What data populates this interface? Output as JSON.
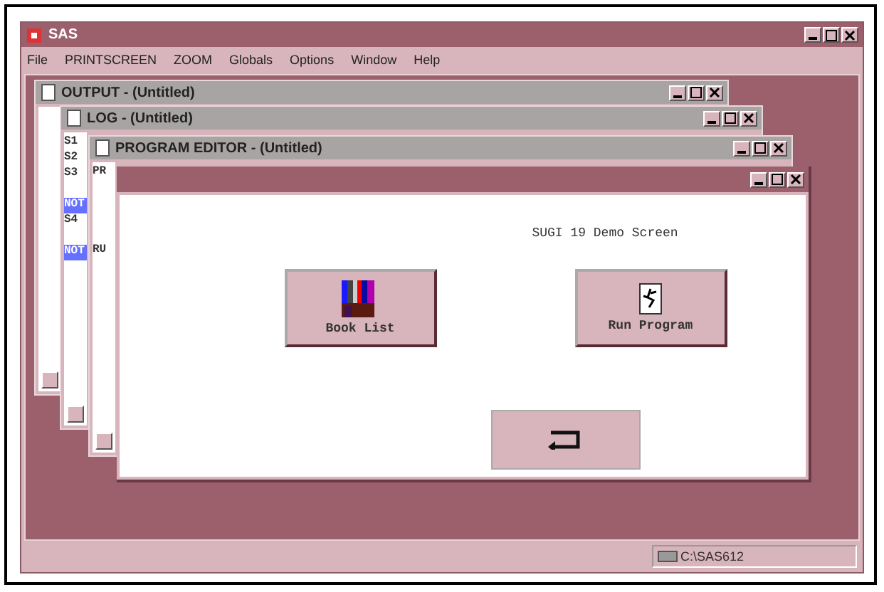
{
  "app_window": {
    "title": "SAS"
  },
  "menu": [
    "File",
    "PRINTSCREEN",
    "ZOOM",
    "Globals",
    "Options",
    "Window",
    "Help"
  ],
  "child_windows": [
    {
      "title": "OUTPUT - (Untitled)",
      "active": false
    },
    {
      "title": "LOG - (Untitled)",
      "active": false,
      "lines": [
        {
          "text": "S1",
          "kind": "plain"
        },
        {
          "text": "S2",
          "kind": "plain"
        },
        {
          "text": "S3",
          "kind": "plain"
        },
        {
          "kind": "gap"
        },
        {
          "text": "NOT",
          "kind": "note"
        },
        {
          "text": "S4",
          "kind": "plain"
        },
        {
          "kind": "gap"
        },
        {
          "text": "NOT",
          "kind": "note"
        }
      ]
    },
    {
      "title": "PROGRAM EDITOR - (Untitled)",
      "active": false,
      "lines": [
        {
          "text": "PR",
          "kind": "plain"
        },
        {
          "kind": "gap"
        },
        {
          "kind": "gap"
        },
        {
          "kind": "gap"
        },
        {
          "kind": "gap"
        },
        {
          "text": "RU",
          "kind": "plain"
        }
      ]
    }
  ],
  "dialog": {
    "heading": "SUGI 19 Demo Screen",
    "buttons": [
      {
        "label": "Book List",
        "kind": "books"
      },
      {
        "label": "Run Program",
        "kind": "run"
      }
    ],
    "back_button": {
      "kind": "return"
    }
  },
  "status_bar": {
    "path": "C:\\SAS612"
  }
}
